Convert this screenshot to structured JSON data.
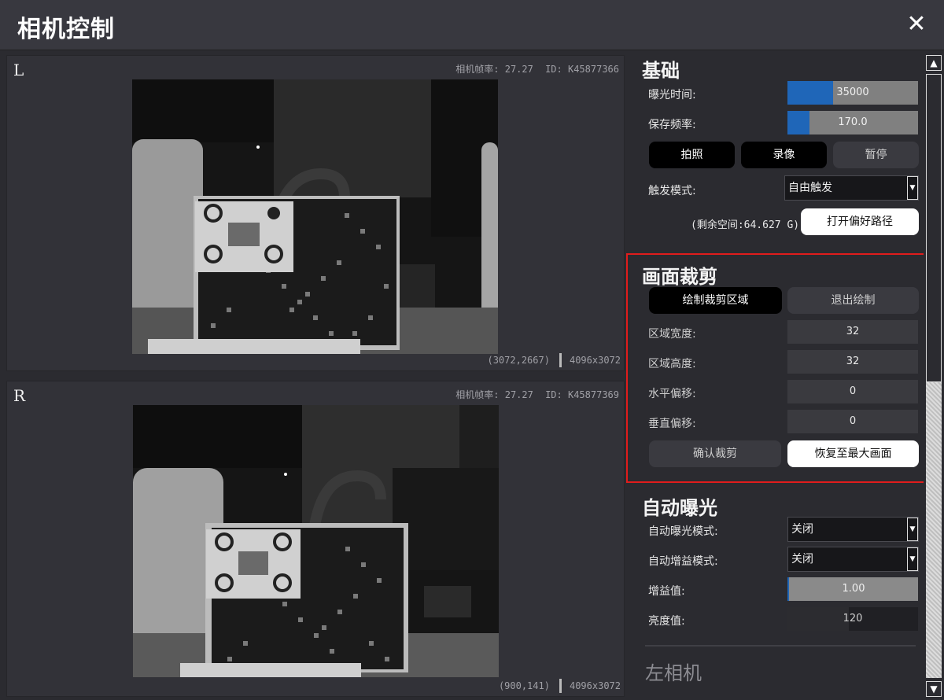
{
  "window": {
    "title": "相机控制",
    "close_icon": "✕"
  },
  "cameras": [
    {
      "letter": "L",
      "fps_label": "相机帧率: 27.27",
      "id_label": "ID: K45877366",
      "cursor": "(3072,2667)",
      "resolution": "4096x3072"
    },
    {
      "letter": "R",
      "fps_label": "相机帧率: 27.27",
      "id_label": "ID: K45877369",
      "cursor": "(900,141)",
      "resolution": "4096x3072"
    }
  ],
  "basic": {
    "title": "基础",
    "exposure_label": "曝光时间:",
    "exposure_value": "35000",
    "exposure_fill": 0.35,
    "save_rate_label": "保存频率:",
    "save_rate_value": "170.0",
    "save_rate_fill": 0.17,
    "photo_button": "拍照",
    "record_button": "录像",
    "pause_button": "暂停",
    "trigger_label": "触发模式:",
    "trigger_value": "自由触发",
    "space_label": "(剩余空间:64.627 G)",
    "open_path_button": "打开偏好路径"
  },
  "crop": {
    "title": "画面裁剪",
    "draw_button": "绘制裁剪区域",
    "exit_button": "退出绘制",
    "width_label": "区域宽度:",
    "width_value": "32",
    "height_label": "区域高度:",
    "height_value": "32",
    "hoffset_label": "水平偏移:",
    "hoffset_value": "0",
    "voffset_label": "垂直偏移:",
    "voffset_value": "0",
    "confirm_button": "确认裁剪",
    "restore_button": "恢复至最大画面"
  },
  "auto_exposure": {
    "title": "自动曝光",
    "ae_mode_label": "自动曝光模式:",
    "ae_mode_value": "关闭",
    "ag_mode_label": "自动增益模式:",
    "ag_mode_value": "关闭",
    "gain_label": "增益值:",
    "gain_value": "1.00",
    "brightness_label": "亮度值:",
    "brightness_value": "120",
    "brightness_fill": 0.47
  },
  "left_camera": {
    "title": "左相机"
  },
  "icons": {
    "scroll_up": "▲",
    "scroll_down": "▼",
    "dropdown": "▼"
  }
}
